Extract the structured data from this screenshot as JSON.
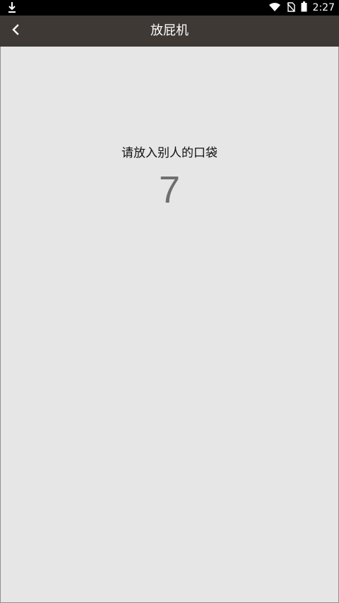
{
  "status_bar": {
    "time": "2:27",
    "icons": [
      "download-icon",
      "wifi-icon",
      "no-sim-icon",
      "battery-icon"
    ]
  },
  "app_bar": {
    "title": "放屁机",
    "back_icon": "chevron-left-icon"
  },
  "main": {
    "instruction": "请放入别人的口袋",
    "countdown": "7"
  },
  "colors": {
    "status_bar_bg": "#000000",
    "app_bar_bg": "#3f3935",
    "page_bg": "#e6e6e6",
    "countdown_text": "#6f6f6f"
  }
}
